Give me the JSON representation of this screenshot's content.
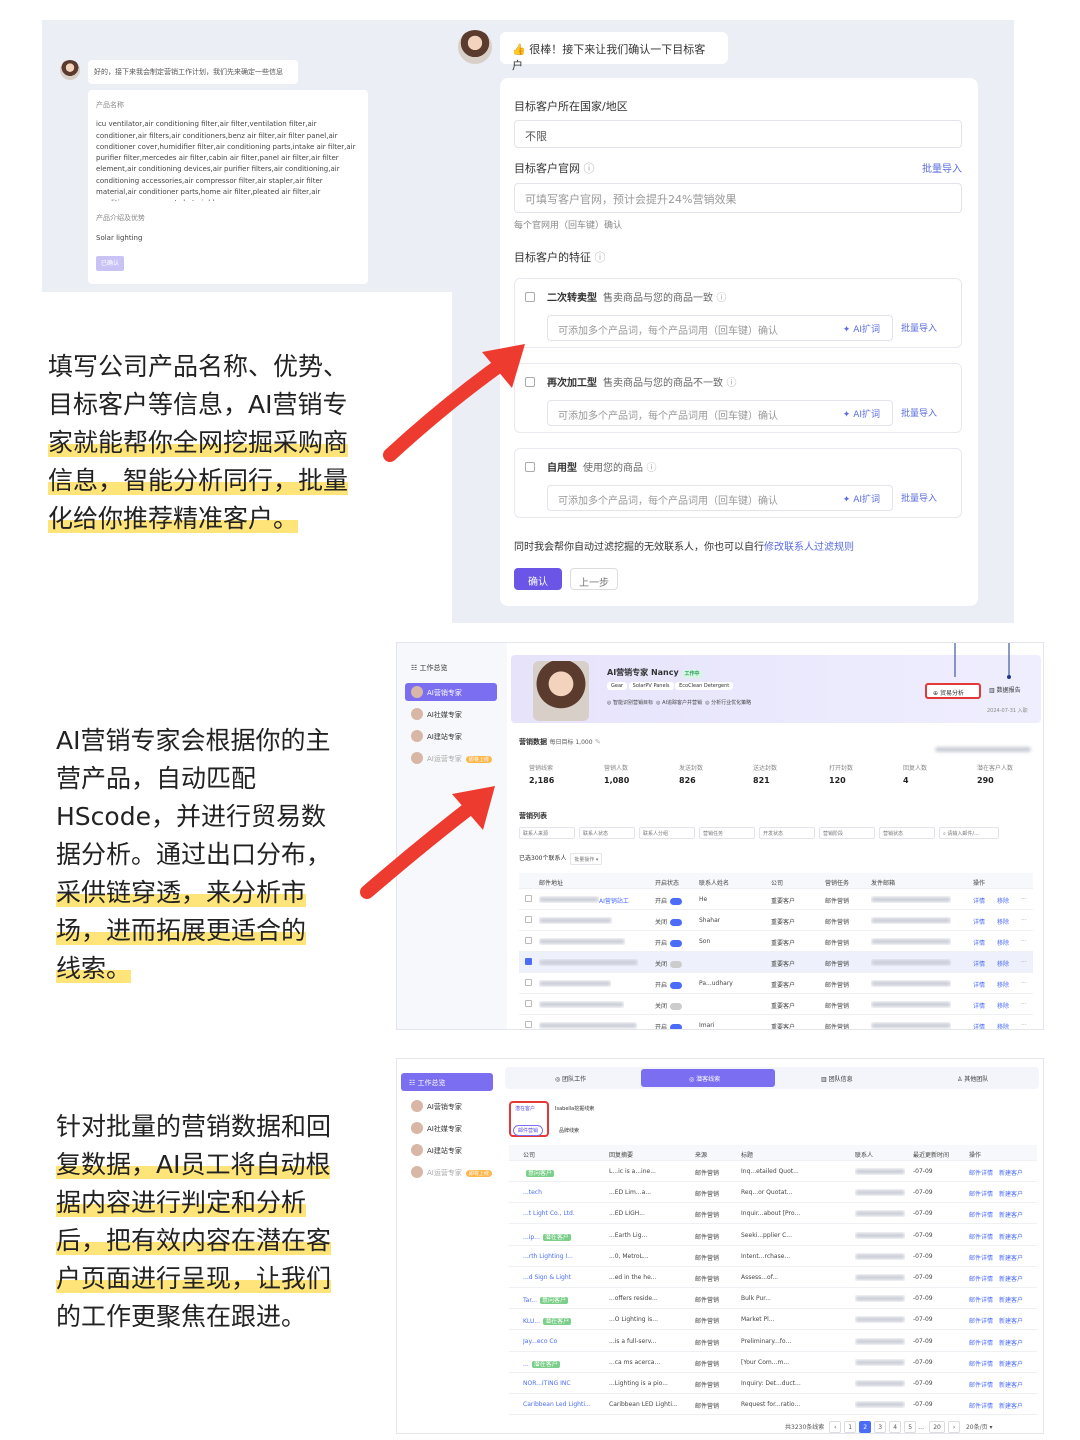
{
  "section1": {
    "left_bubble": "好的，接下来我会制定营销工作计划，我们先来确定一些信息",
    "product_name_label": "产品名称",
    "product_name_value": "icu ventilator,air conditioning filter,air filter,ventilation filter,air conditioner,air filters,air conditioners,benz air filter,air filter panel,air conditioner cover,humidifier filter,air conditioning parts,intake air filter,air purifier filter,mercedes air filter,cabin air filter,panel air filter,air filter element,air conditioning devices,air purifier filters,air conditioning,air conditioning accessories,air compressor filter,air stapler,air filter material,air conditioner parts,home air filter,pleated air filter,air conditioner components,hot air blower",
    "advantage_label": "产品介绍及优势",
    "advantage_value": "Solar lighting",
    "small_button": "已确认",
    "right_bubble": "👍 很棒！接下来让我们确认一下目标客户",
    "country_label": "目标客户所在国家/地区",
    "country_value": "不限",
    "website_label": "目标客户官网",
    "batch_import": "批量导入",
    "website_placeholder": "可填写客户官网，预计会提升24%营销效果",
    "website_hint": "每个官网用（回车键）确认",
    "feature_label": "目标客户的特征",
    "options": [
      {
        "title": "二次转卖型",
        "desc": "售卖商品与您的商品一致",
        "placeholder": "可添加多个产品词，每个产品词用（回车键）确认",
        "ai": "AI扩词",
        "import": "批量导入"
      },
      {
        "title": "再次加工型",
        "desc": "售卖商品与您的商品不一致",
        "placeholder": "可添加多个产品词，每个产品词用（回车键）确认",
        "ai": "AI扩词",
        "import": "批量导入"
      },
      {
        "title": "自用型",
        "desc": "使用您的商品",
        "placeholder": "可添加多个产品词，每个产品词用（回车键）确认",
        "ai": "AI扩词",
        "import": "批量导入"
      }
    ],
    "filter_note": "同时我会帮你自动过滤挖掘的无效联系人，你也可以自行",
    "filter_link": "修改联系人过滤规则",
    "confirm_button": "确认",
    "prev_button": "上一步"
  },
  "captions": {
    "c1_lines": [
      "填写公司产品名称、优势、",
      "目标客户等信息，AI营销专",
      "家就能帮你全网挖掘采购商",
      "信息，智能分析同行，批量",
      "化给你推荐精准客户。"
    ],
    "c2_lines": [
      "AI营销专家会根据你的主",
      "营产品，自动匹配",
      "HScode，并进行贸易数",
      "据分析。通过出口分布，",
      "采供链穿透，来分析市",
      "场，进而拓展更适合的",
      "线索。"
    ],
    "c3_lines": [
      "针对批量的营销数据和回",
      "复数据，AI员工将自动根",
      "据内容进行判定和分析",
      "后，把有效内容在潜在客",
      "户页面进行呈现，让我们",
      "的工作更聚焦在跟进。"
    ]
  },
  "section2": {
    "sidebar_title": "工作总览",
    "sidebar_items": [
      "AI营销专家",
      "AI社媒专家",
      "AI建站专家",
      "AI运营专家"
    ],
    "sidebar_tag": "即将上线",
    "agent_name": "AI营销专家 Nancy",
    "agent_status": "工作中",
    "agent_tags": [
      "Gear",
      "SolarPV Panels",
      "EcoClean Detergent"
    ],
    "agent_tasks": [
      "智能识别营销目标",
      "AI追踪客户并营销",
      "分析行业优化策略"
    ],
    "btn_trade": "贸易分析",
    "btn_report": "数据报告",
    "date_note": "2024-07-31 入职",
    "marketing_data_label": "营销数据",
    "daily_target": "每日目标 1,000",
    "stats": [
      {
        "label": "营销线索",
        "value": "2,186"
      },
      {
        "label": "营销人数",
        "value": "1,080"
      },
      {
        "label": "发送封数",
        "value": "826"
      },
      {
        "label": "送达封数",
        "value": "821"
      },
      {
        "label": "打开封数",
        "value": "120"
      },
      {
        "label": "回复人数",
        "value": "4"
      },
      {
        "label": "潜在客户人数",
        "value": "290"
      }
    ],
    "list_label": "营销列表",
    "filters": [
      "联系人来源",
      "联系人状态",
      "联系人分组",
      "营销任务",
      "开发状态",
      "营销阶段",
      "营销状态"
    ],
    "search_placeholder": "请输入邮件/...",
    "selected_note": "已选300个联系人",
    "batch_op": "批量操作",
    "columns": [
      "邮件地址",
      "开启状态",
      "联系人姓名",
      "公司",
      "营销任务",
      "发件邮箱",
      "操作"
    ],
    "rows": [
      {
        "status": "开启",
        "name": "He",
        "company": "重要客户",
        "task": "邮件营销",
        "tag": "AI营销站工",
        "on": true
      },
      {
        "status": "关闭",
        "name": "Shahar",
        "company": "重要客户",
        "task": "邮件营销",
        "tag": "",
        "on": true
      },
      {
        "status": "开启",
        "name": "Son",
        "company": "重要客户",
        "task": "邮件营销",
        "tag": "",
        "on": true
      },
      {
        "status": "关闭",
        "name": "",
        "company": "重要客户",
        "task": "邮件营销",
        "tag": "",
        "on": false
      },
      {
        "status": "开启",
        "name": "Pa...udhary",
        "company": "重要客户",
        "task": "邮件营销",
        "tag": "",
        "on": true
      },
      {
        "status": "关闭",
        "name": "",
        "company": "重要客户",
        "task": "邮件营销",
        "tag": "",
        "on": false
      },
      {
        "status": "开启",
        "name": "Imari",
        "company": "重要客户",
        "task": "邮件营销",
        "tag": "",
        "on": true
      }
    ],
    "row_actions": [
      "详情",
      "移除"
    ]
  },
  "section3": {
    "sidebar_title": "工作总览",
    "sidebar_items": [
      "AI营销专家",
      "AI社媒专家",
      "AI建站专家",
      "AI运营专家"
    ],
    "sidebar_tag": "即将上线",
    "tabs": [
      "团队工作",
      "潜客线索",
      "团队信息",
      "其他团队"
    ],
    "sub_tabs": [
      "潜在客户",
      "Isabella挖掘线索",
      "邮件营销",
      "品牌线索"
    ],
    "columns": [
      "公司",
      "回复摘要",
      "来源",
      "标题",
      "联系人",
      "最近更新时间",
      "操作"
    ],
    "rows": [
      {
        "company": "",
        "badge": "意向客户",
        "summary": "L...ic is a...ine...",
        "source": "邮件营销",
        "title": "Inq...etailed Quot...",
        "date": "-07-09"
      },
      {
        "company": "...tech",
        "badge": "",
        "summary": "...ED Lim...a...",
        "source": "邮件营销",
        "title": "Req...or Quotat...",
        "date": "-07-09"
      },
      {
        "company": "...t Light Co., Ltd.",
        "badge": "",
        "summary": "...ED LIGH...",
        "source": "邮件营销",
        "title": "Inquir...about [Pro...",
        "date": "-07-09"
      },
      {
        "company": "...ip...",
        "badge": "潜在客户",
        "summary": "...Earth Lig...",
        "source": "邮件营销",
        "title": "Seeki...pplier C...",
        "date": "-07-09"
      },
      {
        "company": "...rth Lighting I...",
        "badge": "",
        "summary": "...0, MetroL...",
        "source": "邮件营销",
        "title": "Intent...rchase...",
        "date": "-07-09"
      },
      {
        "company": "...d Sign & Light",
        "badge": "",
        "summary": "...ed in the he...",
        "source": "邮件营销",
        "title": "Assess...of...",
        "date": "-07-09"
      },
      {
        "company": "Tar...",
        "badge": "意向客户",
        "summary": "...offers reside...",
        "source": "邮件营销",
        "title": "Bulk Pur...",
        "date": "-07-09"
      },
      {
        "company": "KLU...",
        "badge": "潜在客户",
        "summary": "...O Lighting is...",
        "source": "邮件营销",
        "title": "Market Pl...",
        "date": "-07-09"
      },
      {
        "company": "Jay...eco Co",
        "badge": "",
        "summary": "...is a full-serv...",
        "source": "邮件营销",
        "title": "Preliminary...fo...",
        "date": "-07-09"
      },
      {
        "company": "...",
        "badge": "潜在客户",
        "summary": "...ca ms acerca...",
        "source": "邮件营销",
        "title": "[Your Com...m...",
        "date": "-07-09"
      },
      {
        "company": "NOR...ITING INC",
        "badge": "",
        "summary": "...Lighting is a pio...",
        "source": "邮件营销",
        "title": "Inquiry: Det...duct...",
        "date": "-07-09"
      },
      {
        "company": "Caribbean Led Lighti...",
        "badge": "",
        "summary": "Caribbean LED Lighti...",
        "source": "邮件营销",
        "title": "Request for...ratio...",
        "date": "-07-09"
      }
    ],
    "row_actions": [
      "邮件详情",
      "新建客户"
    ],
    "total": "共3230条线索",
    "pages": [
      "1",
      "2",
      "3",
      "4",
      "5",
      "20"
    ],
    "page_size": "20条/页"
  }
}
